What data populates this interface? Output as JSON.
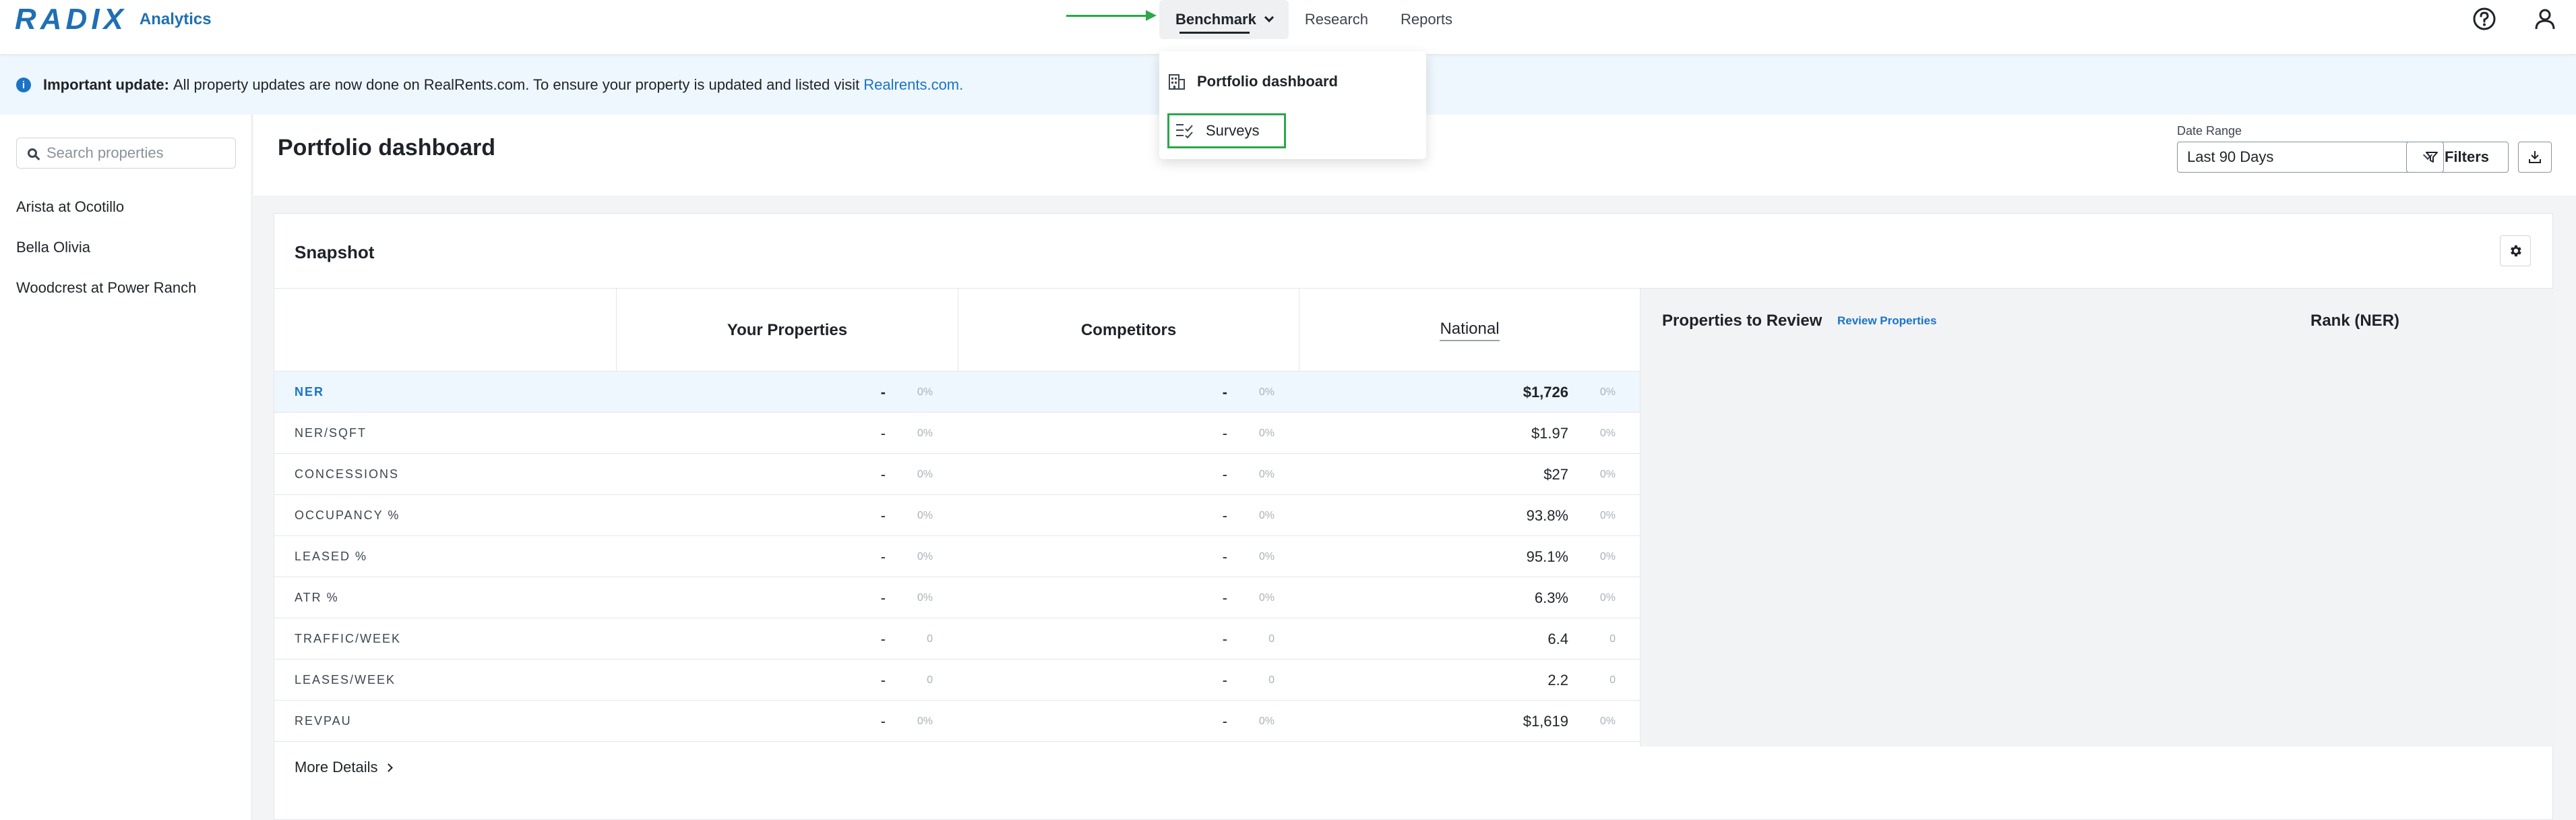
{
  "brand": {
    "logo": "RADIX",
    "product": "Analytics"
  },
  "nav": {
    "items": [
      {
        "label": "Benchmark",
        "active": true
      },
      {
        "label": "Research",
        "active": false
      },
      {
        "label": "Reports",
        "active": false
      }
    ],
    "help_icon": "help-circle-icon",
    "user_icon": "user-icon"
  },
  "dropdown": {
    "items": [
      {
        "label": "Portfolio dashboard",
        "icon": "building-icon"
      },
      {
        "label": "Surveys",
        "icon": "checklist-icon"
      }
    ]
  },
  "banner": {
    "icon": "info-icon",
    "bold": "Important update:",
    "text": "All property updates are now done on RealRents.com. To ensure your property is updated and listed visit",
    "link": "Realrents.com."
  },
  "sidebar": {
    "search_placeholder": "Search properties",
    "properties": [
      "Arista at Ocotillo",
      "Bella Olivia",
      "Woodcrest at Power Ranch"
    ]
  },
  "header": {
    "title": "Portfolio dashboard",
    "date_range_label": "Date Range",
    "date_range_value": "Last 90 Days",
    "filters_label": "Filters"
  },
  "snapshot": {
    "title": "Snapshot",
    "columns": [
      "Your Properties",
      "Competitors",
      "National"
    ],
    "rows": [
      {
        "metric": "NER",
        "yours": "-",
        "yours_pct": "0%",
        "comp": "-",
        "comp_pct": "0%",
        "nat": "$1,726",
        "nat_pct": "0%"
      },
      {
        "metric": "NER/SQFT",
        "yours": "-",
        "yours_pct": "0%",
        "comp": "-",
        "comp_pct": "0%",
        "nat": "$1.97",
        "nat_pct": "0%"
      },
      {
        "metric": "CONCESSIONS",
        "yours": "-",
        "yours_pct": "0%",
        "comp": "-",
        "comp_pct": "0%",
        "nat": "$27",
        "nat_pct": "0%"
      },
      {
        "metric": "OCCUPANCY %",
        "yours": "-",
        "yours_pct": "0%",
        "comp": "-",
        "comp_pct": "0%",
        "nat": "93.8%",
        "nat_pct": "0%"
      },
      {
        "metric": "LEASED %",
        "yours": "-",
        "yours_pct": "0%",
        "comp": "-",
        "comp_pct": "0%",
        "nat": "95.1%",
        "nat_pct": "0%"
      },
      {
        "metric": "ATR %",
        "yours": "-",
        "yours_pct": "0%",
        "comp": "-",
        "comp_pct": "0%",
        "nat": "6.3%",
        "nat_pct": "0%"
      },
      {
        "metric": "TRAFFIC/WEEK",
        "yours": "-",
        "yours_pct": "0",
        "comp": "-",
        "comp_pct": "0",
        "nat": "6.4",
        "nat_pct": "0"
      },
      {
        "metric": "LEASES/WEEK",
        "yours": "-",
        "yours_pct": "0",
        "comp": "-",
        "comp_pct": "0",
        "nat": "2.2",
        "nat_pct": "0"
      },
      {
        "metric": "REVPAU",
        "yours": "-",
        "yours_pct": "0%",
        "comp": "-",
        "comp_pct": "0%",
        "nat": "$1,619",
        "nat_pct": "0%"
      }
    ],
    "more_details": "More Details",
    "review_title": "Properties to Review",
    "review_link": "Review Properties",
    "rank_title": "Rank (NER)"
  },
  "colors": {
    "accent": "#1a73c7",
    "brand": "#1f6fb3",
    "highlight": "#2aa84a",
    "banner_bg": "#eef7fd"
  }
}
